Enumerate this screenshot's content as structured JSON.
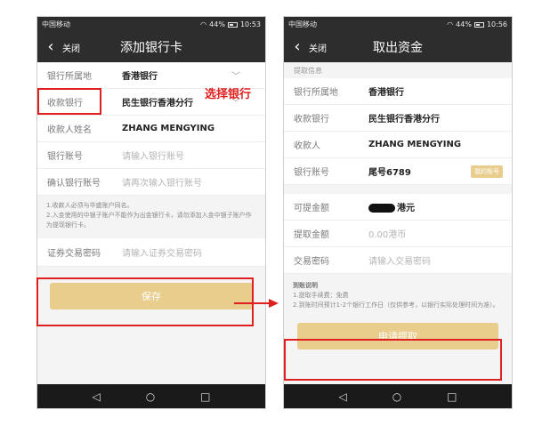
{
  "status_bar": {
    "carrier": "中国移动",
    "battery": "44%",
    "time_left": "10:53",
    "time_right": "10:56"
  },
  "left_screen": {
    "nav": {
      "close": "关闭",
      "title": "添加银行卡"
    },
    "rows": [
      {
        "label": "银行所属地",
        "value": "香港银行"
      },
      {
        "label": "收款银行",
        "value": "民生银行香港分行"
      },
      {
        "label": "收款人姓名",
        "value": "ZHANG MENGYING"
      },
      {
        "label": "银行账号",
        "placeholder": "请输入银行账号"
      },
      {
        "label": "确认银行账号",
        "placeholder": "请再次输入银行账号"
      }
    ],
    "notes": [
      "1.收款人必须与华盛账户同名。",
      "2.入金使用的中银子账户不能作为出金银行卡，请勿添加入金中银子账户作为提现银行卡。"
    ],
    "password_row": {
      "label": "证券交易密码",
      "placeholder": "请输入证券交易密码"
    },
    "save_button": "保存",
    "annotation": "选择银行"
  },
  "right_screen": {
    "nav": {
      "close": "关闭",
      "title": "取出资金"
    },
    "section_title": "提取信息",
    "rows": [
      {
        "label": "银行所属地",
        "value": "香港银行"
      },
      {
        "label": "收款银行",
        "value": "民生银行香港分行"
      },
      {
        "label": "收款人",
        "value": "ZHANG MENGYING"
      },
      {
        "label": "银行账号",
        "value": "尾号6789",
        "badge": "我的账号"
      }
    ],
    "available": {
      "label": "可提金额",
      "suffix": "港元"
    },
    "withdraw_row": {
      "label": "提取金额",
      "placeholder": "0.00港币"
    },
    "password_row": {
      "label": "交易密码",
      "placeholder": "请输入交易密码"
    },
    "notice": {
      "title": "到账说明",
      "items": [
        "1.提取手续费：免费",
        "2.到账时间预计1-2个银行工作日（仅供参考，以银行实际处理时间为准）。"
      ]
    },
    "submit_button": "申请提取"
  }
}
